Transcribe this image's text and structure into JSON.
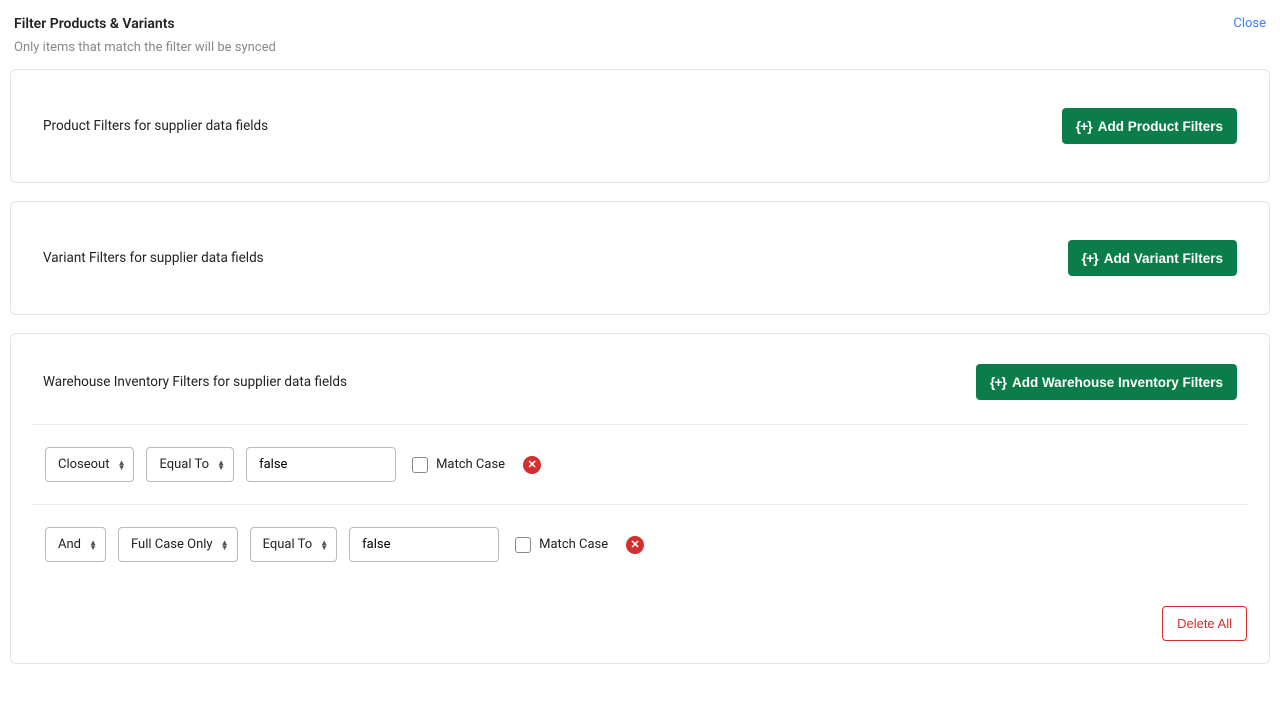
{
  "header": {
    "title": "Filter Products & Variants",
    "close": "Close",
    "subtitle": "Only items that match the filter will be synced"
  },
  "sections": {
    "product": {
      "label": "Product Filters for supplier data fields",
      "add_label": "Add Product Filters"
    },
    "variant": {
      "label": "Variant Filters for supplier data fields",
      "add_label": "Add Variant Filters"
    },
    "warehouse": {
      "label": "Warehouse Inventory Filters for supplier data fields",
      "add_label": "Add Warehouse Inventory Filters",
      "rules": [
        {
          "logic": null,
          "field": "Closeout",
          "operator": "Equal To",
          "value": "false",
          "match_case_label": "Match Case",
          "match_case_checked": false
        },
        {
          "logic": "And",
          "field": "Full Case Only",
          "operator": "Equal To",
          "value": "false",
          "match_case_label": "Match Case",
          "match_case_checked": false
        }
      ],
      "delete_all": "Delete All"
    }
  },
  "icons": {
    "add_prefix": "{+}"
  }
}
